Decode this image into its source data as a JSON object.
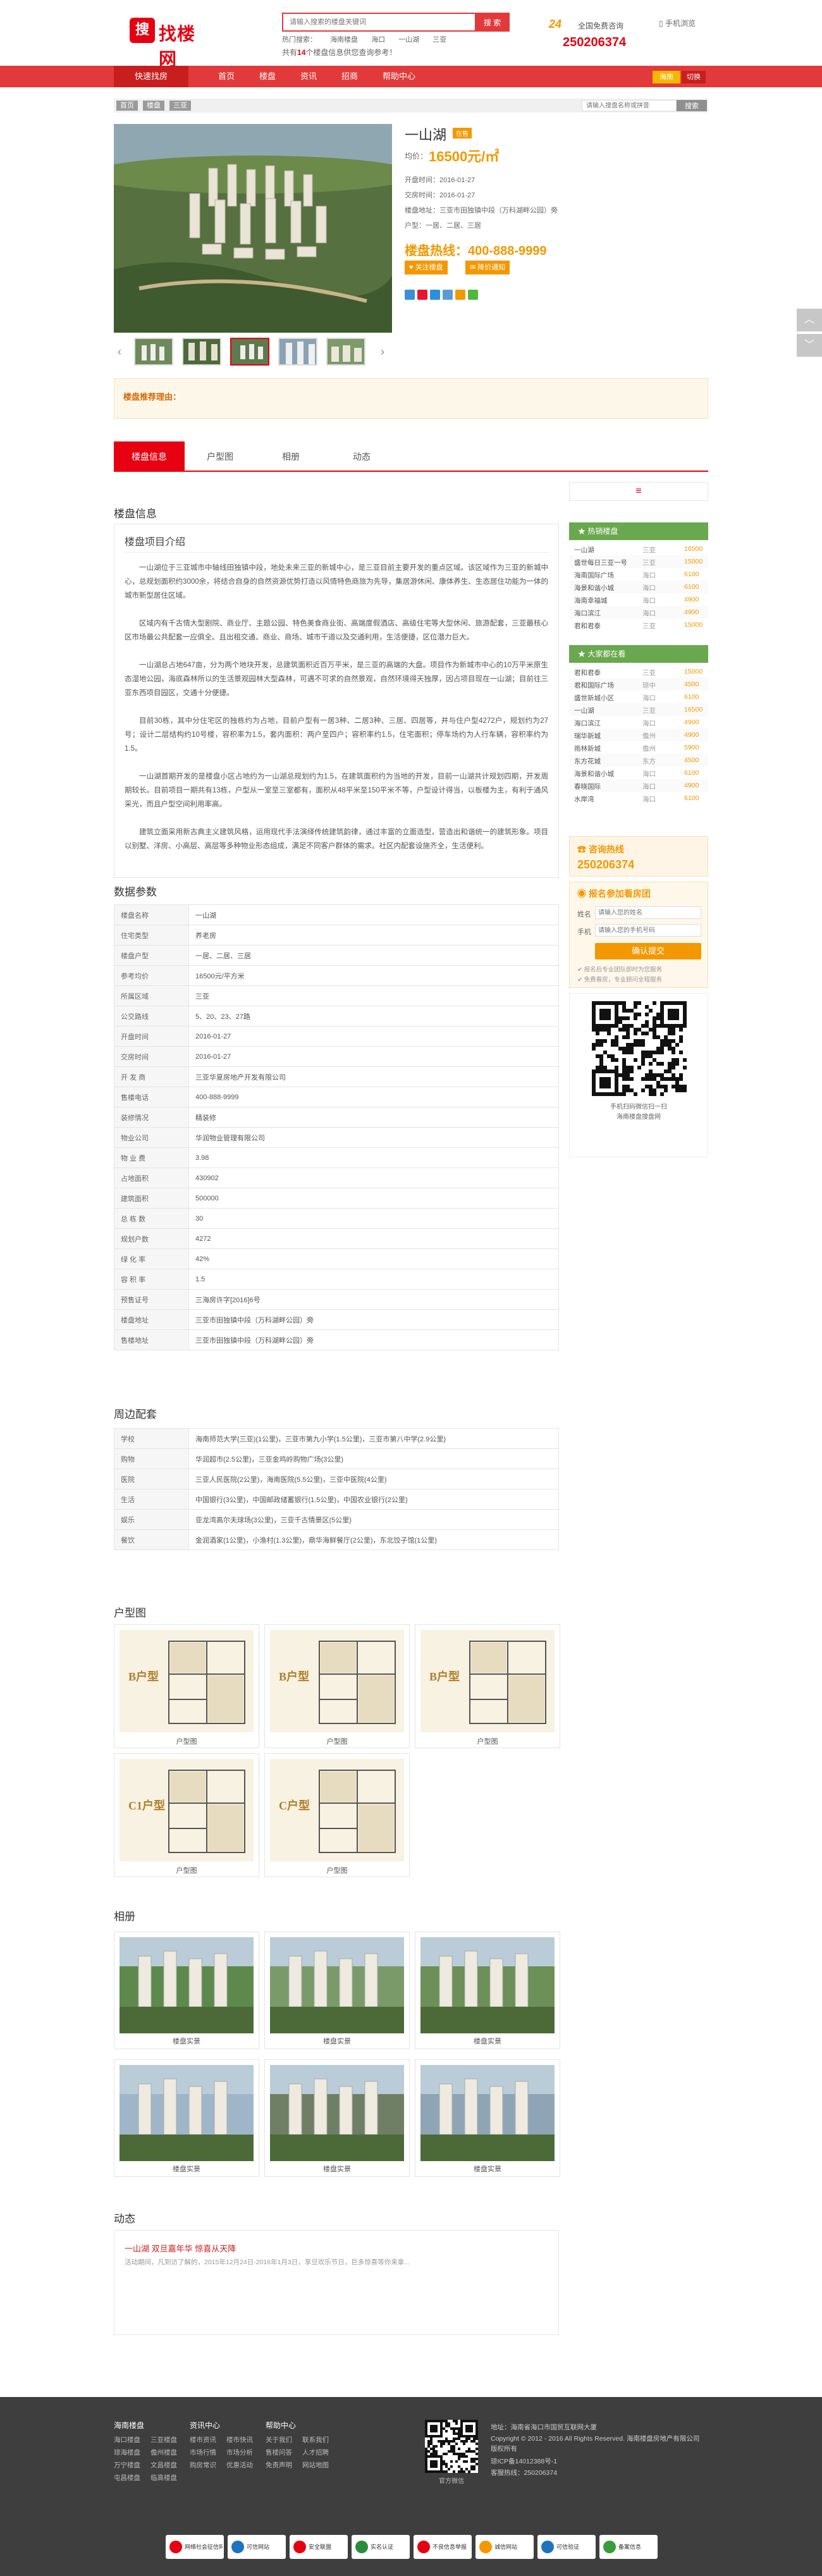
{
  "header": {
    "logo_mark": "搜",
    "logo_text": "找楼网",
    "search_placeholder": "请输入搜索的楼盘关键词",
    "search_button": "搜 索",
    "hot_label": "热门搜索：",
    "hot_terms": [
      "海南楼盘",
      "海口",
      "一山湖",
      "三亚"
    ],
    "promo_prefix": "共有",
    "promo_count": "14",
    "promo_suffix": "个楼盘信息供您查询参考！",
    "hotline_badge": "24",
    "hotline_sub": "全国免费咨询",
    "hotline_number": "250206374",
    "mobile_label": "手机浏览"
  },
  "nav": {
    "quick": "快速找房",
    "items": [
      "首页",
      "楼盘",
      "资讯",
      "招商",
      "帮助中心"
    ],
    "city": "海南",
    "switch": "切换"
  },
  "breadcrumb": {
    "items": [
      "首页",
      "楼盘",
      "三亚"
    ],
    "search_placeholder": "请输入搜盘名称或拼音",
    "search_button": "搜索"
  },
  "property": {
    "name": "一山湖",
    "status_tag": "在售",
    "price_label": "均价：",
    "price": "16500元/㎡",
    "open_date_label": "开盘时间：",
    "open_date": "2016-01-27",
    "delivery_label": "交房时间：",
    "delivery": "2016-01-27",
    "address_label": "楼盘地址：",
    "address": "三亚市田独镇中段（万科湖畔公园）旁",
    "layout_label": "户型：",
    "layouts": "一居、二居、三居",
    "hotline_label": "楼盘热线：",
    "hotline": "400-888-9999",
    "btn_follow": "关注楼盘",
    "btn_notify": "降价通知",
    "recommend_label": "楼盘推荐理由："
  },
  "tabs": [
    "楼盘信息",
    "户型图",
    "相册",
    "动态"
  ],
  "info": {
    "section_title": "楼盘信息",
    "intro_title": "楼盘项目介绍",
    "paragraphs": [
      "一山湖位于三亚城市中轴线田独镇中段，地处未来三亚的新城中心，是三亚目前主要开发的重点区域。该区域作为三亚的新城中心，总规划面积约3000余，将结合自身的自然资源优势打造以风情特色商旅为先导，集居游休闲、康体养生、生态居住功能为一体的城市新型居住区域。",
      "区域内有千古情大型剧院、商业厅、主题公园、特色美食商业街、高端度假酒店、高级住宅等大型休闲、旅游配套，三亚最核心区市场最公共配套一应俱全。且出租交通、商业、商场、城市干道以及交通利用，生活便捷，区位潜力巨大。",
      "一山湖总占地647亩，分为两个地块开发，总建筑面积近百万平米，是三亚的高端的大盘。项目作为新城市中心的10万平米原生态湿地公园，海底森林所以的生活景观园林大型森林，可遇不可求的自然景观，自然环境得天独厚，因占项目现在一山湖；目前往三亚东西项目园区，交通十分便捷。",
      "目前30栋，其中分住宅区的独栋约为占地，目前户型有一居3种、二居3种、三居、四居等，并与住户型4272户，规划约为27号；设计二层结构约10号楼，容积率为1.5，套内面积：两户至四户；容积率约1.5，住宅面积；停车场约为人行车辆，容积率约为1.5。",
      "一山湖首期开发的是楼盘小区占地约为一山湖总规划约为1.5，在建筑面积约为当地的开发，目前一山湖共计规划四期，开发周期较长。目前项目一期共有13栋，户型从一室至三室都有，面积从48平米至150平米不等，户型设计得当，以板楼为主，有利于通风采光，而且户型空间利用率高。",
      "建筑立面采用新古典主义建筑风格，运用现代手法演绎传统建筑韵律，通过丰富的立面造型，营造出和谐统一的建筑形象。项目以别墅、洋房、小高层、高层等多种物业形态组成，满足不同客户群体的需求。社区内配套设施齐全，生活便利。"
    ]
  },
  "params": {
    "title": "数据参数",
    "rows": [
      [
        "楼盘名称",
        "一山湖"
      ],
      [
        "住宅类型",
        "养老房"
      ],
      [
        "楼盘户型",
        "一居、二居、三居"
      ],
      [
        "参考均价",
        "16500元/平方米"
      ],
      [
        "所属区域",
        "三亚"
      ],
      [
        "公交路线",
        "5、20、23、27路"
      ],
      [
        "开盘时间",
        "2016-01-27"
      ],
      [
        "交房时间",
        "2016-01-27"
      ],
      [
        "开 发 商",
        "三亚华夏房地产开发有限公司"
      ],
      [
        "售楼电话",
        "400-888-9999"
      ],
      [
        "装修情况",
        "精装修"
      ],
      [
        "物业公司",
        "华润物业管理有限公司"
      ],
      [
        "物 业 费",
        "3.98"
      ],
      [
        "占地面积",
        "430902"
      ],
      [
        "建筑面积",
        "500000"
      ],
      [
        "总 栋 数",
        "30"
      ],
      [
        "规划户数",
        "4272"
      ],
      [
        "绿 化 率",
        "42%"
      ],
      [
        "容 积 率",
        "1.5"
      ],
      [
        "预售证号",
        "三海房许字[2016]6号"
      ],
      [
        "楼盘地址",
        "三亚市田独镇中段（万科湖畔公园）旁"
      ],
      [
        "售楼地址",
        "三亚市田独镇中段（万科湖畔公园）旁"
      ]
    ]
  },
  "surround": {
    "title": "周边配套",
    "rows": [
      [
        "学校",
        "海南师范大学(三亚)(1公里)，三亚市第九小学(1.5公里)，三亚市第八中学(2.9公里)"
      ],
      [
        "购物",
        "华润超市(2.5公里)，三亚金鸡岭购物广场(3公里)"
      ],
      [
        "医院",
        "三亚人民医院(2公里)，海南医院(5.5公里)，三亚中医院(4公里)"
      ],
      [
        "生活",
        "中国银行(3公里)，中国邮政储蓄银行(1.5公里)，中国农业银行(2公里)"
      ],
      [
        "娱乐",
        "亚龙湾高尔夫球场(3公里)，三亚千古情景区(5公里)"
      ],
      [
        "餐饮",
        "金润酒家(1公里)，小渔村(1.3公里)，鼎华海鲜餐厅(2公里)，东北饺子馆(1公里)"
      ]
    ]
  },
  "plans": {
    "title": "户型图",
    "items": [
      {
        "code": "B户型",
        "caption": "户型图"
      },
      {
        "code": "B户型",
        "caption": "户型图"
      },
      {
        "code": "B户型",
        "caption": "户型图"
      },
      {
        "code": "C1户型",
        "caption": "户型图"
      },
      {
        "code": "C户型",
        "caption": "户型图"
      }
    ]
  },
  "album": {
    "title": "相册",
    "items": [
      "楼盘实景",
      "楼盘实景",
      "楼盘实景",
      "楼盘实景",
      "楼盘实景",
      "楼盘实景"
    ]
  },
  "news": {
    "title": "动态",
    "headline": "一山湖 双旦嘉年华 惊喜从天降",
    "summary": "活动期间，凡到访了解的，2015年12月24日-2016年1月3日，享旦欢乐节日，巨多惊喜等你来拿..."
  },
  "sidebar": {
    "menu_icon": "≡",
    "hot_title": "热销楼盘",
    "hot": [
      [
        "一山湖",
        "三亚",
        "16500"
      ],
      [
        "盛世每日三亚一号",
        "三亚",
        "15000"
      ],
      [
        "海南国际广场",
        "海口",
        "6100"
      ],
      [
        "海景和谐小城",
        "海口",
        "6100"
      ],
      [
        "海南幸福城",
        "海口",
        "4900"
      ],
      [
        "海口滨江",
        "海口",
        "4900"
      ],
      [
        "君和君泰",
        "三亚",
        "15000"
      ]
    ],
    "price_title": "大家都在看",
    "price": [
      [
        "君和君泰",
        "三亚",
        "15000"
      ],
      [
        "君和国际广场",
        "琼中",
        "4500"
      ],
      [
        "盛世新城小区",
        "海口",
        "6100"
      ],
      [
        "一山湖",
        "三亚",
        "16500"
      ],
      [
        "海口滨江",
        "海口",
        "4900"
      ],
      [
        "瑞华新城",
        "儋州",
        "4900"
      ],
      [
        "雨林新城",
        "儋州",
        "5900"
      ],
      [
        "东方花城",
        "东方",
        "4500"
      ],
      [
        "海景和谐小城",
        "海口",
        "6100"
      ],
      [
        "春晓国际",
        "海口",
        "4900"
      ],
      [
        "水岸湾",
        "海口",
        "6100"
      ]
    ],
    "consult_title": "咨询热线",
    "consult_number": "250206374",
    "signup_title": "报名参加看房团",
    "name_label": "姓名",
    "name_placeholder": "请输入您的姓名",
    "phone_label": "手机",
    "phone_placeholder": "请输入您的手机号码",
    "submit": "确认提交",
    "note1": "报名后专业团队即时为您服务",
    "note2": "免费看房，专业顾问全程服务",
    "qr_caption1": "手机扫码微信扫一扫",
    "qr_caption2": "海南楼盘搜盘网"
  },
  "footer": {
    "cols": [
      {
        "head": "海南楼盘",
        "items": [
          "海口楼盘",
          "三亚楼盘",
          "琼海楼盘",
          "儋州楼盘",
          "万宁楼盘",
          "文昌楼盘",
          "屯昌楼盘",
          "临高楼盘"
        ]
      },
      {
        "head": "资讯中心",
        "items": [
          "楼市资讯",
          "楼市快讯",
          "市场行情",
          "市场分析",
          "购房常识",
          "优惠活动"
        ]
      },
      {
        "head": "帮助中心",
        "items": [
          "关于我们",
          "联系我们",
          "售楼问答",
          "人才招聘",
          "免责声明",
          "网站地图"
        ]
      }
    ],
    "qr_caption": "官方微信",
    "address": "地址：海南省海口市国贸互联网大厦",
    "copyright": "Copyright © 2012 - 2016 All Rights Reserved. 海南楼盘房地产有限公司版权所有",
    "icp": "琼ICP备14012388号-1",
    "contact": "客服热线：250206374",
    "badges": [
      "网络社会征信网",
      "可信网站",
      "安全联盟",
      "实名认证",
      "不良信息举报",
      "诚信网站",
      "可信验证",
      "备案信息"
    ]
  },
  "colors": {
    "brand": "#e23a3a",
    "accent": "#f39800",
    "side_green": "#6aa84f"
  }
}
